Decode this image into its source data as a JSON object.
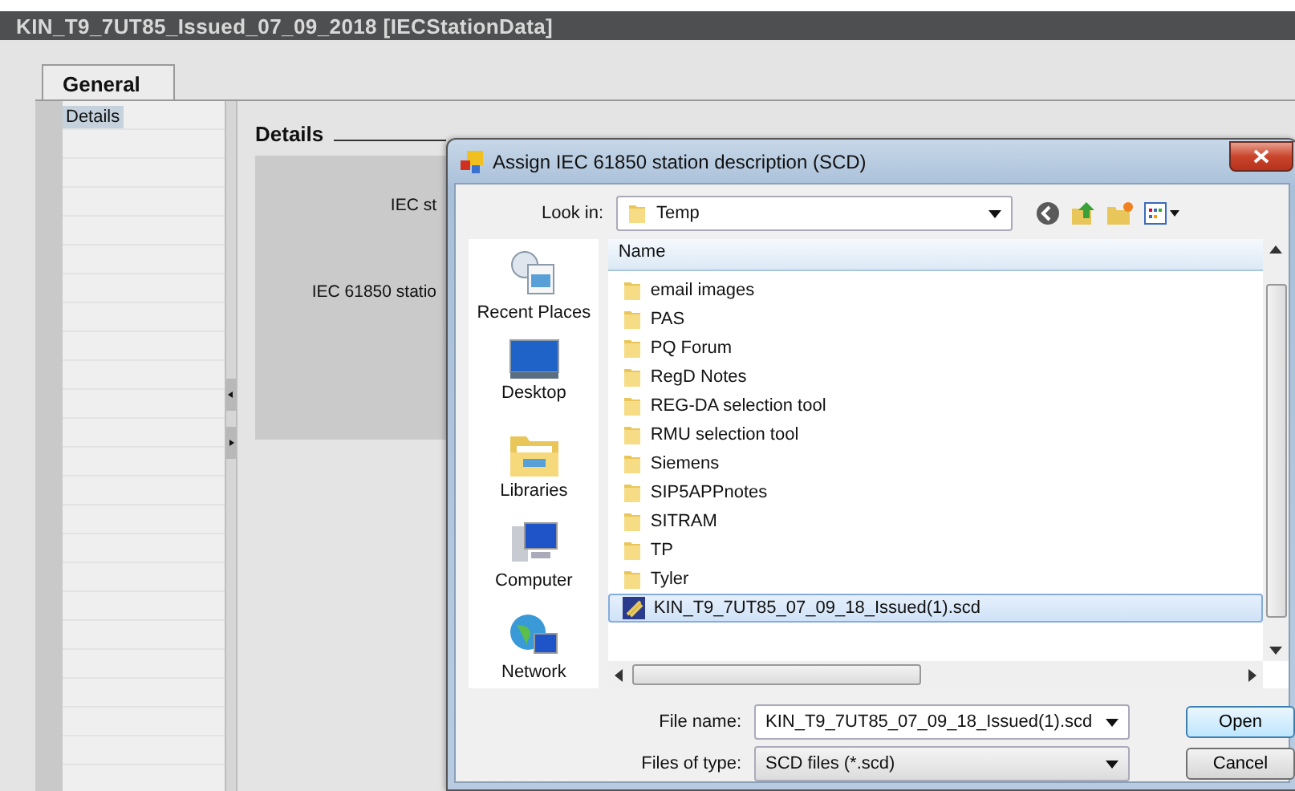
{
  "window": {
    "title": "KIN_T9_7UT85_Issued_07_09_2018 [IECStationData]"
  },
  "tabs": [
    {
      "label": "General",
      "selected": true
    }
  ],
  "sidebar": {
    "items": [
      {
        "label": "Details",
        "selected": true
      }
    ]
  },
  "section": {
    "heading": "Details",
    "fields": [
      {
        "label": "IEC st"
      },
      {
        "label": "IEC 61850 statio"
      }
    ]
  },
  "dialog": {
    "title": "Assign IEC 61850 station description (SCD)",
    "look_in": {
      "label": "Look in:",
      "value": "Temp"
    },
    "places": [
      {
        "label": "Recent Places",
        "kind": "recent"
      },
      {
        "label": "Desktop",
        "kind": "desktop"
      },
      {
        "label": "Libraries",
        "kind": "libraries"
      },
      {
        "label": "Computer",
        "kind": "computer"
      },
      {
        "label": "Network",
        "kind": "network"
      }
    ],
    "list_header": "Name",
    "files": [
      {
        "name": "email images",
        "kind": "folder",
        "selected": false
      },
      {
        "name": "PAS",
        "kind": "folder",
        "selected": false
      },
      {
        "name": "PQ Forum",
        "kind": "folder",
        "selected": false
      },
      {
        "name": "RegD Notes",
        "kind": "folder",
        "selected": false
      },
      {
        "name": "REG-DA selection tool",
        "kind": "folder",
        "selected": false
      },
      {
        "name": "RMU selection tool",
        "kind": "folder",
        "selected": false
      },
      {
        "name": "Siemens",
        "kind": "folder",
        "selected": false
      },
      {
        "name": "SIP5APPnotes",
        "kind": "folder",
        "selected": false
      },
      {
        "name": "SITRAM",
        "kind": "folder",
        "selected": false
      },
      {
        "name": "TP",
        "kind": "folder",
        "selected": false
      },
      {
        "name": "Tyler",
        "kind": "folder",
        "selected": false
      },
      {
        "name": "KIN_T9_7UT85_07_09_18_Issued(1).scd",
        "kind": "file",
        "selected": true
      }
    ],
    "file_name": {
      "label": "File name:",
      "value": "KIN_T9_7UT85_07_09_18_Issued(1).scd"
    },
    "file_type": {
      "label": "Files of type:",
      "value": "SCD files (*.scd)"
    },
    "buttons": [
      {
        "label": "Open",
        "default": true
      },
      {
        "label": "Cancel",
        "default": false
      }
    ]
  }
}
